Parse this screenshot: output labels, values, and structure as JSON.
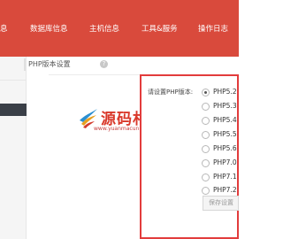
{
  "nav": {
    "items": [
      {
        "label": "息"
      },
      {
        "label": "数据库信息"
      },
      {
        "label": "主机信息"
      },
      {
        "label": "工具&服务"
      },
      {
        "label": "操作日志"
      }
    ]
  },
  "section": {
    "title": "PHP版本设置",
    "help_icon": "?"
  },
  "php": {
    "label": "请设置PHP版本:",
    "options": [
      {
        "label": "PHP5.2",
        "selected": true
      },
      {
        "label": "PHP5.3",
        "selected": false
      },
      {
        "label": "PHP5.4",
        "selected": false
      },
      {
        "label": "PHP5.5",
        "selected": false
      },
      {
        "label": "PHP5.6",
        "selected": false
      },
      {
        "label": "PHP7.0",
        "selected": false
      },
      {
        "label": "PHP7.1",
        "selected": false
      },
      {
        "label": "PHP7.2",
        "selected": false
      }
    ],
    "save_label": "保存设置"
  },
  "watermark": {
    "title": "源码村",
    "url": "www.yuanmacun.com"
  },
  "colors": {
    "topbar": "#d94a3c",
    "panel_border": "#e23c3c",
    "sidebar_active": "#3a3f47"
  }
}
